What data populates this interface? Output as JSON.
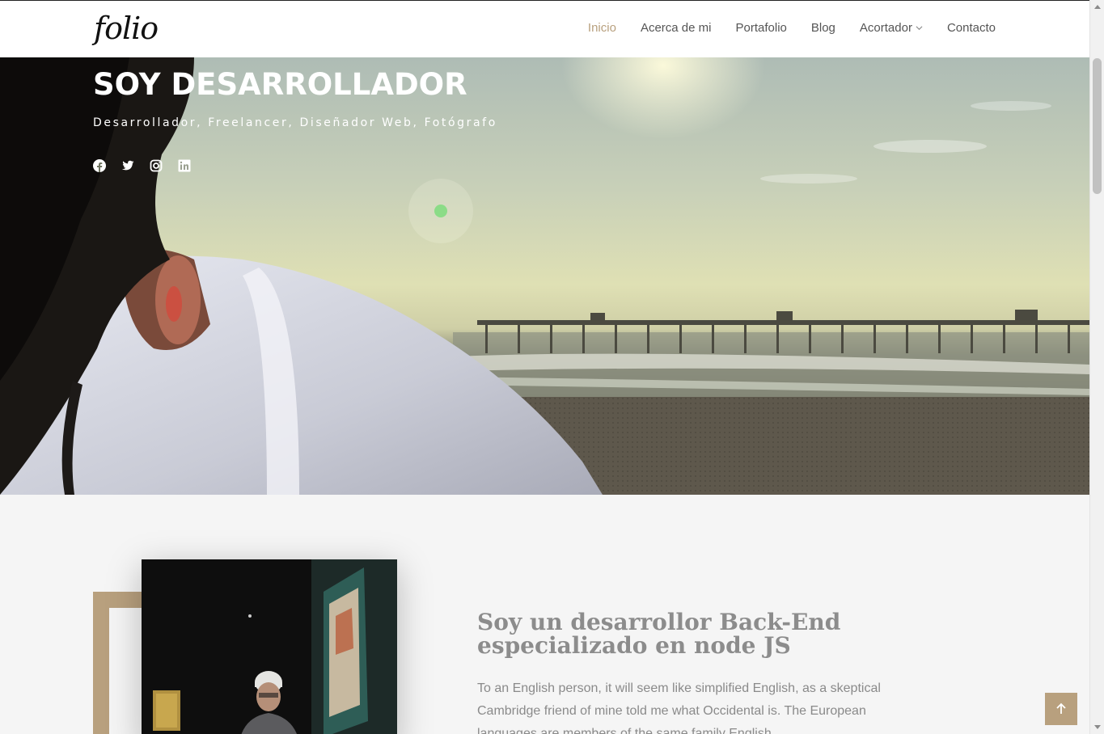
{
  "header": {
    "logo": "folio",
    "nav": [
      {
        "label": "Inicio",
        "active": true
      },
      {
        "label": "Acerca de mi"
      },
      {
        "label": "Portafolio"
      },
      {
        "label": "Blog"
      },
      {
        "label": "Acortador",
        "dropdown": true
      },
      {
        "label": "Contacto"
      }
    ]
  },
  "hero": {
    "title": "SOY DESARROLLADOR",
    "subtitle": "Desarrollador, Freelancer, Diseñador Web, Fotógrafo",
    "socials": [
      "facebook-icon",
      "twitter-icon",
      "instagram-icon",
      "linkedin-icon"
    ]
  },
  "about": {
    "heading": "Soy un desarrollor Back-End especializado en node JS",
    "text": "To an English person, it will seem like simplified English, as a skeptical Cambridge friend of mine told me what Occidental is. The European languages are members of the same family English"
  },
  "colors": {
    "accent": "#b8a07e",
    "nav_text": "#555555",
    "heading_text": "#8c8c8c",
    "body_text": "#8a8a8a",
    "background": "#f5f5f5"
  },
  "back_to_top": {
    "icon": "arrow-up-icon"
  }
}
